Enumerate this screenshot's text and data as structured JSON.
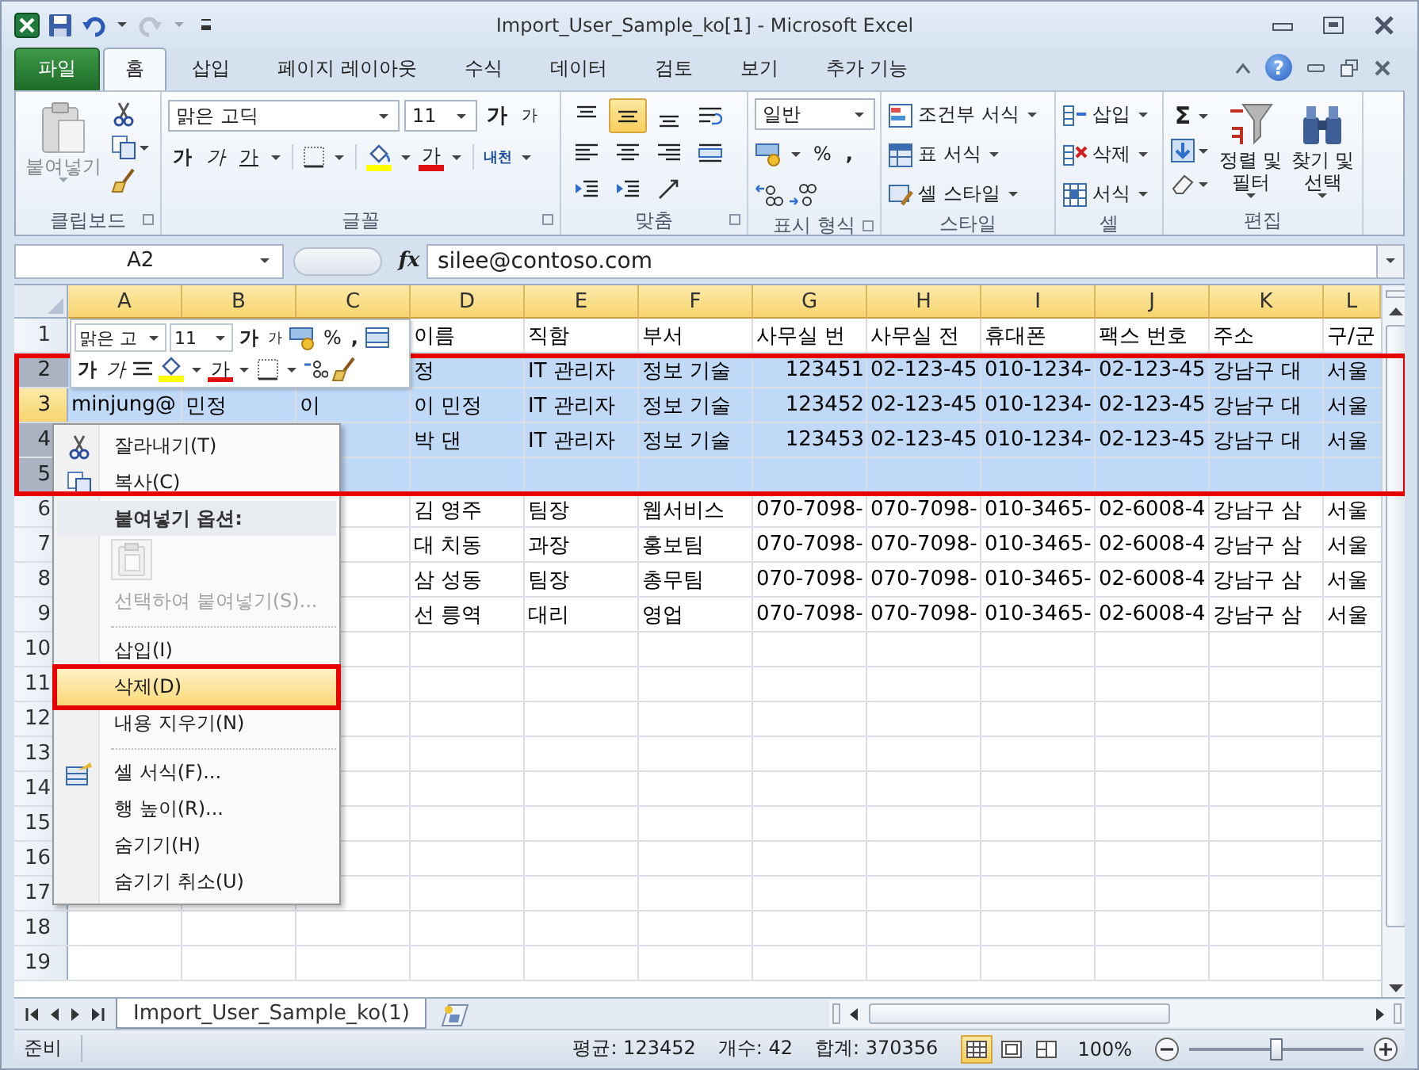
{
  "window": {
    "title": "Import_User_Sample_ko[1]  -  Microsoft Excel",
    "help": "?"
  },
  "ribbon_tabs": [
    {
      "label": "파일",
      "kind": "file",
      "selected": false
    },
    {
      "label": "홈",
      "kind": "tab",
      "selected": true
    },
    {
      "label": "삽입",
      "kind": "tab",
      "selected": false
    },
    {
      "label": "페이지 레이아웃",
      "kind": "tab",
      "selected": false
    },
    {
      "label": "수식",
      "kind": "tab",
      "selected": false
    },
    {
      "label": "데이터",
      "kind": "tab",
      "selected": false
    },
    {
      "label": "검토",
      "kind": "tab",
      "selected": false
    },
    {
      "label": "보기",
      "kind": "tab",
      "selected": false
    },
    {
      "label": "추가 기능",
      "kind": "tab",
      "selected": false
    }
  ],
  "ribbon": {
    "clipboard": {
      "label": "클립보드",
      "paste": "붙여넣기"
    },
    "font": {
      "label": "글꼴",
      "font_name": "맑은 고딕",
      "font_size": "11",
      "grow": "가",
      "shrink": "가",
      "bold": "가",
      "italic": "가",
      "underline": "가",
      "font_color": "가",
      "phonetic": "내천"
    },
    "alignment": {
      "label": "맞춤",
      "buttons": [
        {
          "kind": "top",
          "selected": false
        },
        {
          "kind": "middle",
          "selected": true
        },
        {
          "kind": "bottom",
          "selected": false
        },
        {
          "kind": "wrap",
          "selected": false
        },
        {
          "kind": "left",
          "selected": false
        },
        {
          "kind": "center",
          "selected": false
        },
        {
          "kind": "right",
          "selected": false
        },
        {
          "kind": "merge",
          "selected": false
        },
        {
          "kind": "outdent",
          "selected": false
        },
        {
          "kind": "indent",
          "selected": false
        },
        {
          "kind": "orientation",
          "selected": false
        }
      ]
    },
    "number": {
      "label": "표시 형식",
      "format": "일반",
      "percent": "%",
      "comma": ","
    },
    "styles": {
      "label": "스타일",
      "items": [
        {
          "kind": "conditional",
          "label": "조건부 서식"
        },
        {
          "kind": "table",
          "label": "표 서식"
        },
        {
          "kind": "cell_style",
          "label": "셀 스타일"
        }
      ]
    },
    "cells": {
      "label": "셀",
      "items": [
        {
          "kind": "insert",
          "label": "삽입"
        },
        {
          "kind": "delete",
          "label": "삭제"
        },
        {
          "kind": "format",
          "label": "서식"
        }
      ]
    },
    "editing": {
      "label": "편집",
      "sum": "Σ",
      "sort": "정렬 및 필터",
      "find": "찾기 및 선택"
    }
  },
  "formula_bar": {
    "name_box": "A2",
    "function_label": "fx",
    "value": "silee@contoso.com"
  },
  "sheet": {
    "columns": [
      {
        "label": "A",
        "selected": true
      },
      {
        "label": "B",
        "selected": true
      },
      {
        "label": "C",
        "selected": true
      },
      {
        "label": "D",
        "selected": true
      },
      {
        "label": "E",
        "selected": true
      },
      {
        "label": "F",
        "selected": true
      },
      {
        "label": "G",
        "selected": true
      },
      {
        "label": "H",
        "selected": true
      },
      {
        "label": "I",
        "selected": true
      },
      {
        "label": "J",
        "selected": true
      },
      {
        "label": "K",
        "selected": true
      },
      {
        "label": "L",
        "selected": true
      }
    ],
    "rows": [
      {
        "number": "1",
        "selected": false,
        "active": false,
        "cells": {
          "D": "이름",
          "E": "직함",
          "F": "부서",
          "G": "사무실 번",
          "H": "사무실 전",
          "I": "휴대폰",
          "J": "팩스 번호",
          "K": "주소",
          "L": "구/군"
        }
      },
      {
        "number": "2",
        "selected": true,
        "active": false,
        "cells": {
          "D": "정",
          "E": "IT 관리자",
          "F": "정보 기술",
          "G": {
            "text": "123451",
            "kind": "number"
          },
          "H": "02-123-45",
          "I": "010-1234-",
          "J": "02-123-45",
          "K": "강남구 대",
          "L": "서울"
        }
      },
      {
        "number": "3",
        "selected": true,
        "active": true,
        "cells": {
          "A": "minjung@",
          "B": "민정",
          "C": "이",
          "D": "이 민정",
          "E": "IT 관리자",
          "F": "정보 기술",
          "G": {
            "text": "123452",
            "kind": "number"
          },
          "H": "02-123-45",
          "I": "010-1234-",
          "J": "02-123-45",
          "K": "강남구 대",
          "L": "서울"
        }
      },
      {
        "number": "4",
        "selected": true,
        "active": false,
        "cells": {
          "D": "박 댄",
          "E": "IT 관리자",
          "F": "정보 기술",
          "G": {
            "text": "123453",
            "kind": "number"
          },
          "H": "02-123-45",
          "I": "010-1234-",
          "J": "02-123-45",
          "K": "강남구 대",
          "L": "서울"
        }
      },
      {
        "number": "5",
        "selected": true,
        "active": false
      },
      {
        "number": "6",
        "selected": false,
        "active": false,
        "cells": {
          "D": "김 영주",
          "E": "팀장",
          "F": "웹서비스",
          "G": "070-7098-",
          "H": "070-7098-",
          "I": "010-3465-",
          "J": "02-6008-4",
          "K": "강남구 삼",
          "L": "서울"
        }
      },
      {
        "number": "7",
        "selected": false,
        "active": false,
        "cells": {
          "D": "대 치동",
          "E": "과장",
          "F": "홍보팀",
          "G": "070-7098-",
          "H": "070-7098-",
          "I": "010-3465-",
          "J": "02-6008-4",
          "K": "강남구 삼",
          "L": "서울"
        }
      },
      {
        "number": "8",
        "selected": false,
        "active": false,
        "cells": {
          "D": "삼 성동",
          "E": "팀장",
          "F": "총무팀",
          "G": "070-7098-",
          "H": "070-7098-",
          "I": "010-3465-",
          "J": "02-6008-4",
          "K": "강남구 삼",
          "L": "서울"
        }
      },
      {
        "number": "9",
        "selected": false,
        "active": false,
        "cells": {
          "D": "선 릉역",
          "E": "대리",
          "F": "영업",
          "G": "070-7098-",
          "H": "070-7098-",
          "I": "010-3465-",
          "J": "02-6008-4",
          "K": "강남구 삼",
          "L": "서울"
        }
      },
      {
        "number": "10",
        "selected": false,
        "active": false
      },
      {
        "number": "11",
        "selected": false,
        "active": false
      },
      {
        "number": "12",
        "selected": false,
        "active": false
      },
      {
        "number": "13",
        "selected": false,
        "active": false
      },
      {
        "number": "14",
        "selected": false,
        "active": false
      },
      {
        "number": "15",
        "selected": false,
        "active": false
      },
      {
        "number": "16",
        "selected": false,
        "active": false
      },
      {
        "number": "17",
        "selected": false,
        "active": false
      },
      {
        "number": "18",
        "selected": false,
        "active": false
      },
      {
        "number": "19",
        "selected": false,
        "active": false
      }
    ]
  },
  "mini_toolbar": {
    "font_name": "맑은 고",
    "font_size": "11",
    "grow": "가",
    "shrink": "가",
    "percent": "%",
    "comma": ",",
    "bold": "가",
    "italic": "가",
    "font_color": "가"
  },
  "context_menu": {
    "items": [
      {
        "kind": "cut",
        "label": "잘라내기(T)",
        "disabled": false,
        "selected": false
      },
      {
        "kind": "copy",
        "label": "복사(C)",
        "disabled": false,
        "selected": false
      },
      {
        "kind": "heading",
        "label": "붙여넣기 옵션:"
      },
      {
        "kind": "paste_option",
        "disabled": true
      },
      {
        "kind": "command",
        "label": "선택하여 붙여넣기(S)...",
        "disabled": true,
        "selected": false
      },
      {
        "kind": "separator"
      },
      {
        "kind": "command",
        "label": "삽입(I)",
        "disabled": false,
        "selected": false
      },
      {
        "kind": "command",
        "label": "삭제(D)",
        "disabled": false,
        "selected": true
      },
      {
        "kind": "command",
        "label": "내용 지우기(N)",
        "disabled": false,
        "selected": false
      },
      {
        "kind": "separator"
      },
      {
        "kind": "format_cells",
        "label": "셀 서식(F)...",
        "disabled": false,
        "selected": false
      },
      {
        "kind": "command",
        "label": "행 높이(R)...",
        "disabled": false,
        "selected": false
      },
      {
        "kind": "command",
        "label": "숨기기(H)",
        "disabled": false,
        "selected": false
      },
      {
        "kind": "command",
        "label": "숨기기 취소(U)",
        "disabled": false,
        "selected": false
      }
    ]
  },
  "sheet_tabs": [
    {
      "label": "Import_User_Sample_ko(1)",
      "selected": true
    }
  ],
  "status_bar": {
    "mode": "준비",
    "average": "평균: 123452",
    "count": "개수: 42",
    "sum": "합계: 370356",
    "views": [
      {
        "kind": "normal",
        "selected": true
      },
      {
        "kind": "page_layout",
        "selected": false
      },
      {
        "kind": "page_break",
        "selected": false
      }
    ],
    "zoom": "100%",
    "zoom_slider": {
      "level": 0.5
    }
  }
}
